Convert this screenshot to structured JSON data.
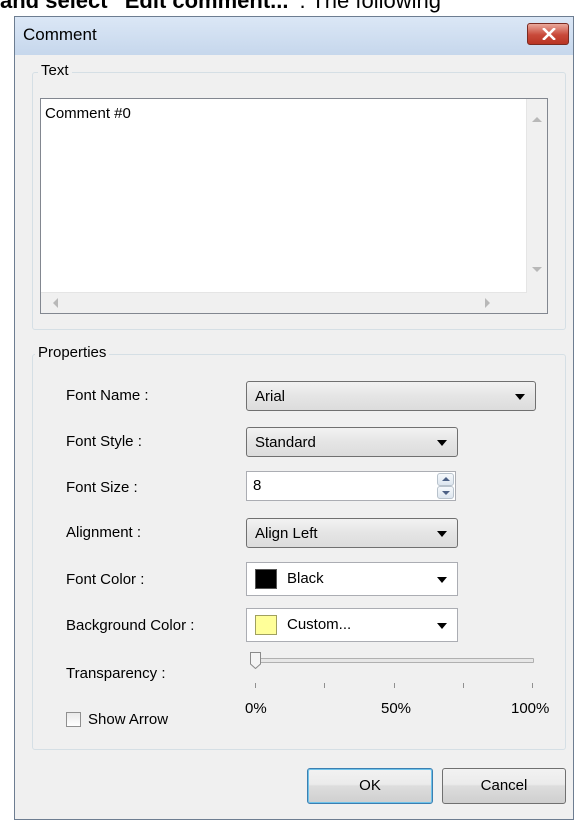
{
  "background_instruction": {
    "bold_part": "and select “Edit comment...”",
    "plain_part": ". The following"
  },
  "dialog": {
    "title": "Comment",
    "text_group": {
      "legend": "Text",
      "content": "Comment #0"
    },
    "properties_group": {
      "legend": "Properties",
      "font_name": {
        "label": "Font Name :",
        "value": "Arial"
      },
      "font_style": {
        "label": "Font Style :",
        "value": "Standard"
      },
      "font_size": {
        "label": "Font Size :",
        "value": "8"
      },
      "alignment": {
        "label": "Alignment :",
        "value": "Align Left"
      },
      "font_color": {
        "label": "Font Color :",
        "value": "Black",
        "swatch": "#000000"
      },
      "background_color": {
        "label": "Background Color :",
        "value": "Custom...",
        "swatch": "#ffff99"
      },
      "transparency": {
        "label": "Transparency :",
        "value_percent": 0,
        "tick_labels": [
          "0%",
          "50%",
          "100%"
        ]
      },
      "show_arrow": {
        "label": "Show Arrow",
        "checked": false
      }
    },
    "buttons": {
      "ok": "OK",
      "cancel": "Cancel"
    },
    "icons": {
      "close": "close-icon",
      "dropdown": "chevron-down-icon"
    }
  }
}
